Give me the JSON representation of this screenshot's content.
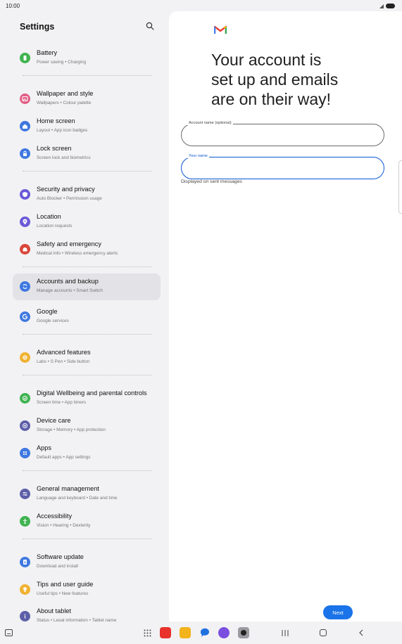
{
  "status_bar": {
    "time": "10:00"
  },
  "settings": {
    "title": "Settings",
    "items": [
      {
        "id": "battery",
        "title": "Battery",
        "subtitle": "Power saving  •  Charging",
        "icon": "battery-icon",
        "color": "#3fb34f"
      },
      {
        "id": "wallpaper",
        "title": "Wallpaper and style",
        "subtitle": "Wallpapers  •  Colour palette",
        "icon": "wallpaper-icon",
        "color": "#e25f86"
      },
      {
        "id": "home-screen",
        "title": "Home screen",
        "subtitle": "Layout  •  App icon badges",
        "icon": "home-screen-icon",
        "color": "#3f78e0"
      },
      {
        "id": "lock-screen",
        "title": "Lock screen",
        "subtitle": "Screen lock and biometrics",
        "icon": "lock-icon",
        "color": "#3f78e0"
      },
      {
        "id": "security",
        "title": "Security and privacy",
        "subtitle": "Auto Blocker  •  Permission usage",
        "icon": "shield-icon",
        "color": "#6a5ad8"
      },
      {
        "id": "location",
        "title": "Location",
        "subtitle": "Location requests",
        "icon": "location-pin-icon",
        "color": "#6a5ad8"
      },
      {
        "id": "safety",
        "title": "Safety and emergency",
        "subtitle": "Medical info  •  Wireless emergency alerts",
        "icon": "emergency-icon",
        "color": "#d9463a"
      },
      {
        "id": "accounts",
        "title": "Accounts and backup",
        "subtitle": "Manage accounts  •  Smart Switch",
        "icon": "sync-icon",
        "color": "#3f78e0"
      },
      {
        "id": "google",
        "title": "Google",
        "subtitle": "Google services",
        "icon": "google-icon",
        "color": "#3f78e0"
      },
      {
        "id": "advanced",
        "title": "Advanced features",
        "subtitle": "Labs  •  S Pen  •  Side button",
        "icon": "gear-plus-icon",
        "color": "#f0b232"
      },
      {
        "id": "wellbeing",
        "title": "Digital Wellbeing and parental controls",
        "subtitle": "Screen time  •  App timers",
        "icon": "wellbeing-icon",
        "color": "#3fb34f"
      },
      {
        "id": "device-care",
        "title": "Device care",
        "subtitle": "Storage  •  Memory  •  App protection",
        "icon": "device-care-icon",
        "color": "#5d5fa8"
      },
      {
        "id": "apps",
        "title": "Apps",
        "subtitle": "Default apps  •  App settings",
        "icon": "apps-icon",
        "color": "#3f78e0"
      },
      {
        "id": "general",
        "title": "General management",
        "subtitle": "Language and keyboard  •  Date and time",
        "icon": "sliders-icon",
        "color": "#5d5fa8"
      },
      {
        "id": "accessibility",
        "title": "Accessibility",
        "subtitle": "Vision  •  Hearing  •  Dexterity",
        "icon": "accessibility-icon",
        "color": "#3fb34f"
      },
      {
        "id": "software-update",
        "title": "Software update",
        "subtitle": "Download and install",
        "icon": "update-icon",
        "color": "#3f78e0"
      },
      {
        "id": "tips",
        "title": "Tips and user guide",
        "subtitle": "Useful tips  •  New features",
        "icon": "bulb-icon",
        "color": "#f0b232"
      },
      {
        "id": "about",
        "title": "About tablet",
        "subtitle": "Status  •  Legal information  •  Tablet name",
        "icon": "info-icon",
        "color": "#5d5fa8"
      }
    ]
  },
  "gmail_setup": {
    "heading": "Your account is\nset up and emails\nare on their way!",
    "account_name_label": "Account name (optional)",
    "account_name_value": "",
    "your_name_label": "Your name",
    "your_name_value": "",
    "helper": "Displayed on sent messages",
    "next_label": "Next"
  },
  "nav_bar": {
    "dock_apps": [
      {
        "name": "dock-app-red",
        "color": "#e8322b"
      },
      {
        "name": "dock-app-folder",
        "color": "#f2b31d"
      },
      {
        "name": "dock-app-messages",
        "color": "#1f6fe0"
      },
      {
        "name": "dock-app-internet",
        "color": "#7a4fe0"
      },
      {
        "name": "dock-app-camera",
        "color": "#9a9aa0"
      }
    ]
  }
}
